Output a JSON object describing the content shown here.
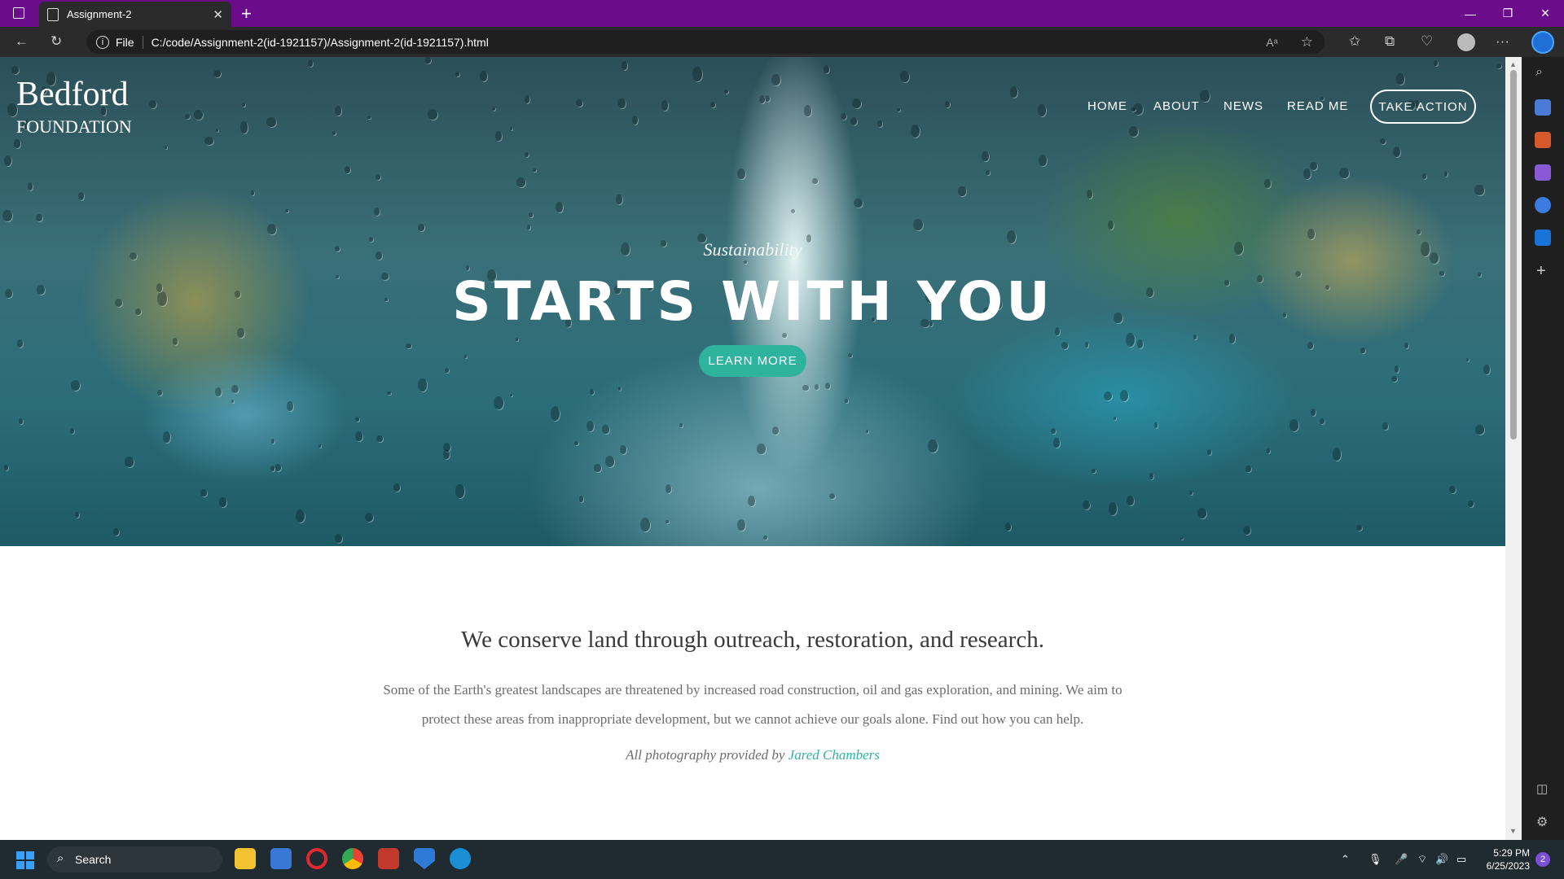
{
  "browser": {
    "tab_title": "Assignment-2",
    "new_tab_symbol": "+",
    "site_info_label": "File",
    "url": "C:/code/Assignment-2(id-1921157)/Assignment-2(id-1921157).html"
  },
  "site": {
    "logo_line1": "Bedford",
    "logo_line2": "FOUNDATION",
    "nav": [
      "HOME",
      "ABOUT",
      "NEWS",
      "READ ME"
    ],
    "cta_label": "TAKE ACTION",
    "hero_subtitle": "Sustainability",
    "hero_headline": "STARTS WITH YOU",
    "learn_more_label": "LEARN MORE",
    "lead": "We conserve land through outreach, restoration, and research.",
    "body": "Some of the Earth's greatest landscapes are threatened by increased road construction, oil and gas exploration, and mining. We aim to protect these areas from inappropriate development, but we cannot achieve our goals alone. Find out how you can help.",
    "credit_prefix": "All photography provided by",
    "credit_name": "Jared Chambers",
    "accent_color": "#2eb39f"
  },
  "taskbar": {
    "search_label": "Search",
    "time": "5:29 PM",
    "date": "6/25/2023",
    "notification_count": "2"
  }
}
